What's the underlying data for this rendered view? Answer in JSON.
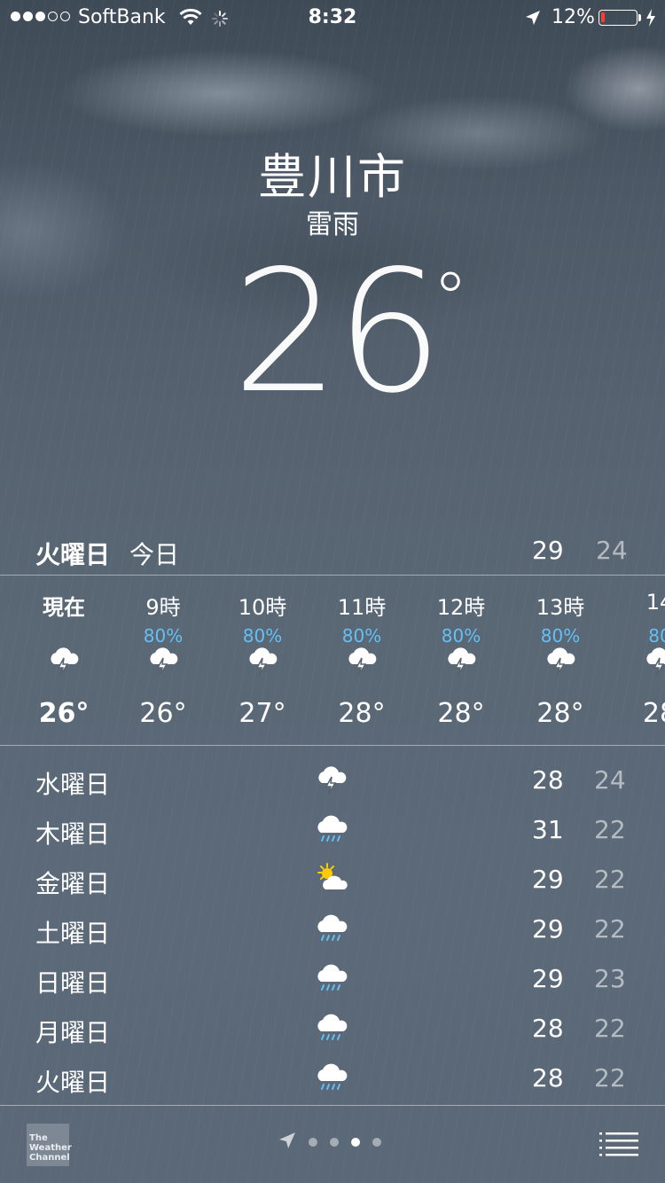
{
  "status_bar": {
    "carrier": "SoftBank",
    "time": "8:32",
    "battery_percent": "12%",
    "battery_level": 0.12,
    "battery_color": "#ff3b30",
    "signal_bars_filled": 3,
    "signal_bars_total": 5,
    "icons": [
      "wifi-icon",
      "activity-spinner-icon",
      "location-arrow-icon",
      "charging-bolt-icon"
    ]
  },
  "location": {
    "city": "豊川市",
    "condition": "雷雨",
    "temperature": "26",
    "degree": "°"
  },
  "today": {
    "day": "火曜日",
    "label": "今日",
    "high": "29",
    "low": "24"
  },
  "hourly": [
    {
      "label": "現在",
      "pop": "",
      "icon": "thunderstorm-icon",
      "temp": "26°",
      "bold": true
    },
    {
      "label": "9時",
      "pop": "80%",
      "icon": "thunderstorm-icon",
      "temp": "26°"
    },
    {
      "label": "10時",
      "pop": "80%",
      "icon": "thunderstorm-icon",
      "temp": "27°"
    },
    {
      "label": "11時",
      "pop": "80%",
      "icon": "thunderstorm-icon",
      "temp": "28°"
    },
    {
      "label": "12時",
      "pop": "80%",
      "icon": "thunderstorm-icon",
      "temp": "28°"
    },
    {
      "label": "13時",
      "pop": "80%",
      "icon": "thunderstorm-icon",
      "temp": "28°"
    },
    {
      "label": "14",
      "pop": "80",
      "icon": "thunderstorm-icon",
      "temp": "28"
    }
  ],
  "daily": [
    {
      "day": "水曜日",
      "icon": "thunderstorm-icon",
      "high": "28",
      "low": "24"
    },
    {
      "day": "木曜日",
      "icon": "rain-icon",
      "high": "31",
      "low": "22"
    },
    {
      "day": "金曜日",
      "icon": "partly-sunny-icon",
      "high": "29",
      "low": "22"
    },
    {
      "day": "土曜日",
      "icon": "rain-icon",
      "high": "29",
      "low": "22"
    },
    {
      "day": "日曜日",
      "icon": "rain-icon",
      "high": "29",
      "low": "23"
    },
    {
      "day": "月曜日",
      "icon": "rain-icon",
      "high": "28",
      "low": "22"
    },
    {
      "day": "火曜日",
      "icon": "rain-icon",
      "high": "28",
      "low": "22"
    }
  ],
  "footer": {
    "logo_text": [
      "The",
      "Weather",
      "Channel"
    ],
    "page_count": 4,
    "active_page": 3,
    "icons": [
      "current-location-arrow-icon",
      "city-list-icon"
    ]
  },
  "colors": {
    "precip_blue": "#64bff5",
    "sun_yellow": "#ffcc00"
  }
}
